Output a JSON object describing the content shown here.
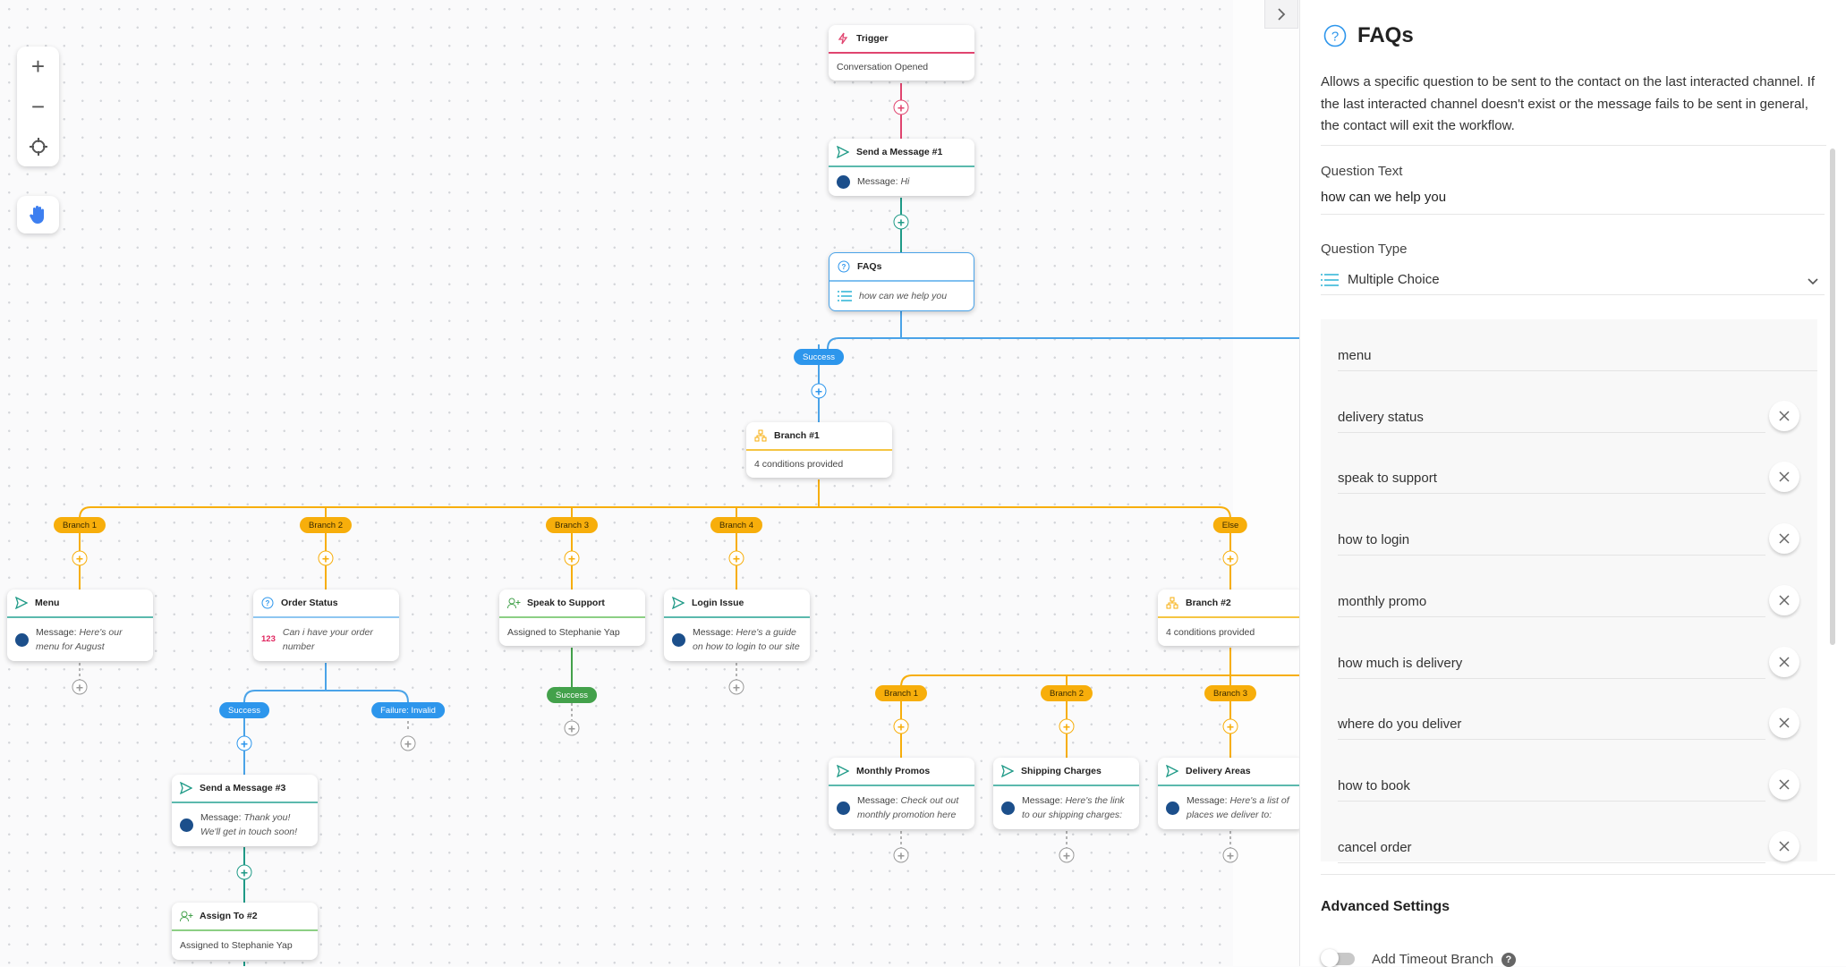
{
  "canvas": {
    "zoom_controls": {
      "zoom_in": "+",
      "zoom_out": "−",
      "recenter_icon": "crosshair-icon",
      "pan_icon": "hand-icon"
    },
    "colors": {
      "trigger": "#e0446f",
      "message": "#1f9a87",
      "faq": "#2d96ec",
      "branch": "#f7ae0b",
      "assign": "#43a14b",
      "empty": "#999999"
    },
    "nodes": {
      "trigger": {
        "title": "Trigger",
        "body": "Conversation Opened"
      },
      "send1": {
        "title": "Send a Message #1",
        "label": "Message:",
        "value": "Hi"
      },
      "faqs": {
        "title": "FAQs",
        "value": "how can we help you"
      },
      "branch1": {
        "title": "Branch #1",
        "body": "4 conditions provided"
      },
      "menu": {
        "title": "Menu",
        "label": "Message:",
        "value": "Here's our menu for August"
      },
      "order_status": {
        "title": "Order Status",
        "badge": "123",
        "value": "Can i have your order number"
      },
      "speak_support": {
        "title": "Speak to Support",
        "body": "Assigned to Stephanie Yap"
      },
      "login_issue": {
        "title": "Login Issue",
        "label": "Message:",
        "value": "Here's a guide on how to login to our site"
      },
      "branch2": {
        "title": "Branch #2",
        "body": "4 conditions provided"
      },
      "send3": {
        "title": "Send a Message #3",
        "label": "Message:",
        "value": "Thank you! We'll get in touch soon!"
      },
      "assign2": {
        "title": "Assign To #2",
        "body": "Assigned to Stephanie Yap"
      },
      "monthly_promos": {
        "title": "Monthly Promos",
        "label": "Message:",
        "value": "Check out out monthly promotion here"
      },
      "shipping": {
        "title": "Shipping Charges",
        "label": "Message:",
        "value": "Here's the link to our shipping charges:"
      },
      "delivery_areas": {
        "title": "Delivery Areas",
        "label": "Message:",
        "value": "Here's a list of places we deliver to:"
      }
    },
    "pills": {
      "faq_success": "Success",
      "b1": "Branch 1",
      "b2": "Branch 2",
      "b3": "Branch 3",
      "b4": "Branch 4",
      "else": "Else",
      "os_success": "Success",
      "os_failure": "Failure: Invalid",
      "ss_success": "Success",
      "b2_1": "Branch 1",
      "b2_2": "Branch 2",
      "b2_3": "Branch 3"
    }
  },
  "panel": {
    "collapse_icon": "chevron-right-icon",
    "title": "FAQs",
    "description": "Allows a specific question to be sent to the contact on the last interacted channel. If the last interacted channel doesn't exist or the message fails to be sent in general, the contact will exit the workflow.",
    "question_text_label": "Question Text",
    "question_text_value": "how can we help you",
    "question_type_label": "Question Type",
    "question_type_value": "Multiple Choice",
    "options": [
      "menu",
      "delivery status",
      "speak to support",
      "how to login",
      "monthly promo",
      "how much is delivery",
      "where do you deliver",
      "how to book",
      "cancel order"
    ],
    "advanced_settings": "Advanced Settings",
    "timeout_label": "Add Timeout Branch",
    "timeout_enabled": false,
    "accent": "#2d96ec"
  }
}
